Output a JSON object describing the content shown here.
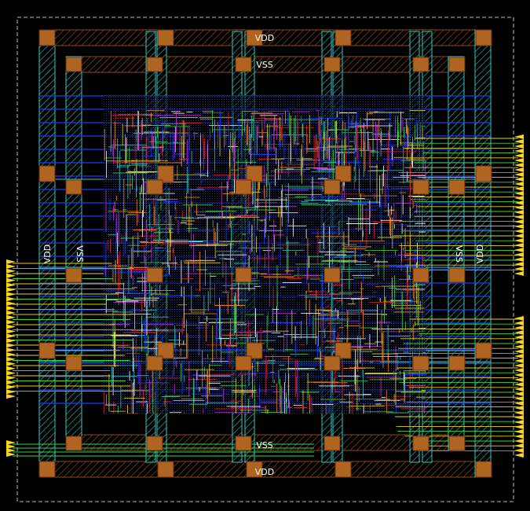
{
  "layout_view": {
    "power_nets": {
      "vdd_label": "VDD",
      "vss_label": "VSS"
    },
    "colors": {
      "background": "#000000",
      "boundary": "#bdbdbd",
      "vdd_ring": "#8a4a1e",
      "vdd_pad": "#b06422",
      "vss_ring": "#6d3a16",
      "stripe_cyan": "#36c6c0",
      "metal1_blue": "#1a3cff",
      "metal2_green": "#39d24a",
      "metal3_yellow": "#e4d21c",
      "metal4_red": "#e0202a",
      "metal5_magenta": "#c22fd8",
      "pin_yellow": "#f5d623"
    },
    "labels": {
      "top_vdd": "VDD",
      "top_vss": "VSS",
      "bottom_vss": "VSS",
      "bottom_vdd": "VDD",
      "left_vdd": "VDD",
      "left_vss": "VSS",
      "right_vss": "VSS",
      "right_vdd": "VDD"
    }
  }
}
